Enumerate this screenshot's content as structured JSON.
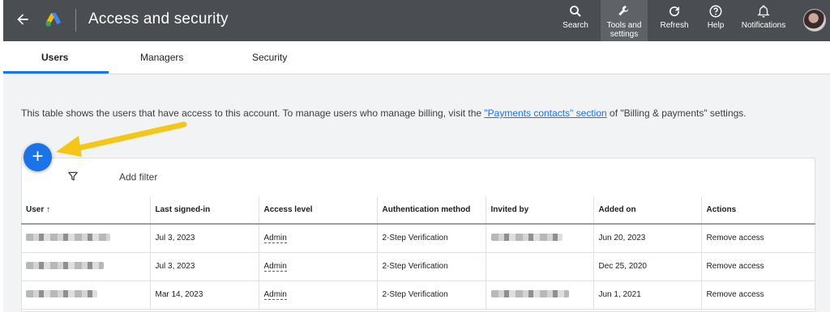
{
  "header": {
    "title": "Access and security",
    "tools": [
      {
        "label": "Search",
        "icon": "search-icon"
      },
      {
        "label": "Tools and settings",
        "icon": "wrench-icon"
      },
      {
        "label": "Refresh",
        "icon": "refresh-icon"
      },
      {
        "label": "Help",
        "icon": "help-icon"
      },
      {
        "label": "Notifications",
        "icon": "bell-icon"
      }
    ]
  },
  "tabs": [
    {
      "label": "Users",
      "selected": true
    },
    {
      "label": "Managers",
      "selected": false
    },
    {
      "label": "Security",
      "selected": false
    }
  ],
  "info": {
    "before": "This table shows the users that have access to this account. To manage users who manage billing, visit the ",
    "link": "\"Payments contacts\" section",
    "after": " of \"Billing & payments\" settings."
  },
  "filter": {
    "label": "Add filter",
    "icon": "filter-icon"
  },
  "fab": {
    "label": "+",
    "icon": "add-icon"
  },
  "table": {
    "columns": [
      "User",
      "Last signed-in",
      "Access level",
      "Authentication method",
      "Invited by",
      "Added on",
      "Actions"
    ],
    "rows": [
      {
        "last_signed_in": "Jul 3, 2023",
        "access": "Admin",
        "auth": "2-Step Verification",
        "added_on": "Jun 20, 2023",
        "action": "Remove access"
      },
      {
        "last_signed_in": "Jul 3, 2023",
        "access": "Admin",
        "auth": "2-Step Verification",
        "added_on": "Dec 25, 2020",
        "action": "Remove access"
      },
      {
        "last_signed_in": "Mar 14, 2023",
        "access": "Admin",
        "auth": "2-Step Verification",
        "added_on": "Jun 1, 2021",
        "action": "Remove access"
      }
    ]
  },
  "colors": {
    "topbar": "#4a4d51",
    "accent": "#1a73e8",
    "arrow": "#f5c518"
  }
}
